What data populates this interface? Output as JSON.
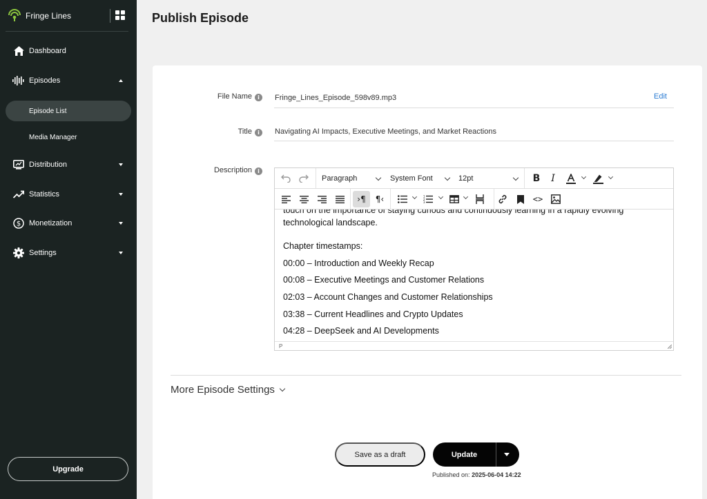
{
  "brand": {
    "name": "Fringe Lines"
  },
  "sidebar": {
    "items": [
      {
        "label": "Dashboard",
        "icon": "home-icon"
      },
      {
        "label": "Episodes",
        "icon": "waveform-icon",
        "expanded": true
      },
      {
        "label": "Distribution",
        "icon": "monitor-icon"
      },
      {
        "label": "Statistics",
        "icon": "trend-icon"
      },
      {
        "label": "Monetization",
        "icon": "dollar-icon"
      },
      {
        "label": "Settings",
        "icon": "gear-icon"
      }
    ],
    "episode_sub": [
      {
        "label": "Episode List",
        "active": true
      },
      {
        "label": "Media Manager"
      }
    ],
    "upgrade_label": "Upgrade"
  },
  "page": {
    "title": "Publish Episode"
  },
  "form": {
    "file_name": {
      "label": "File Name",
      "value": "Fringe_Lines_Episode_598v89.mp3",
      "edit_label": "Edit"
    },
    "title": {
      "label": "Title",
      "value": "Navigating AI Impacts, Executive Meetings, and Market Reactions"
    },
    "description": {
      "label": "Description"
    }
  },
  "editor": {
    "block_format": "Paragraph",
    "font_family": "System Font",
    "font_size": "12pt",
    "lines": [
      "touch on the importance of staying curious and continuously learning in a rapidly evolving",
      "technological landscape.",
      "Chapter timestamps:",
      "00:00 – Introduction and Weekly Recap",
      "00:08 – Executive Meetings and Customer Relations",
      "02:03 – Account Changes and Customer Relationships",
      "03:38 – Current Headlines and Crypto Updates",
      "04:28 – DeepSeek and AI Developments"
    ],
    "status_path": "P"
  },
  "more_settings_label": "More Episode Settings",
  "actions": {
    "draft_label": "Save as a draft",
    "update_label": "Update",
    "published_prefix": "Published on:",
    "published_date": "2025-06-04 14:22"
  },
  "colors": {
    "sidebar_bg": "#1b2322",
    "accent_link": "#2b7cd3",
    "brand_green": "#8dc63f"
  }
}
